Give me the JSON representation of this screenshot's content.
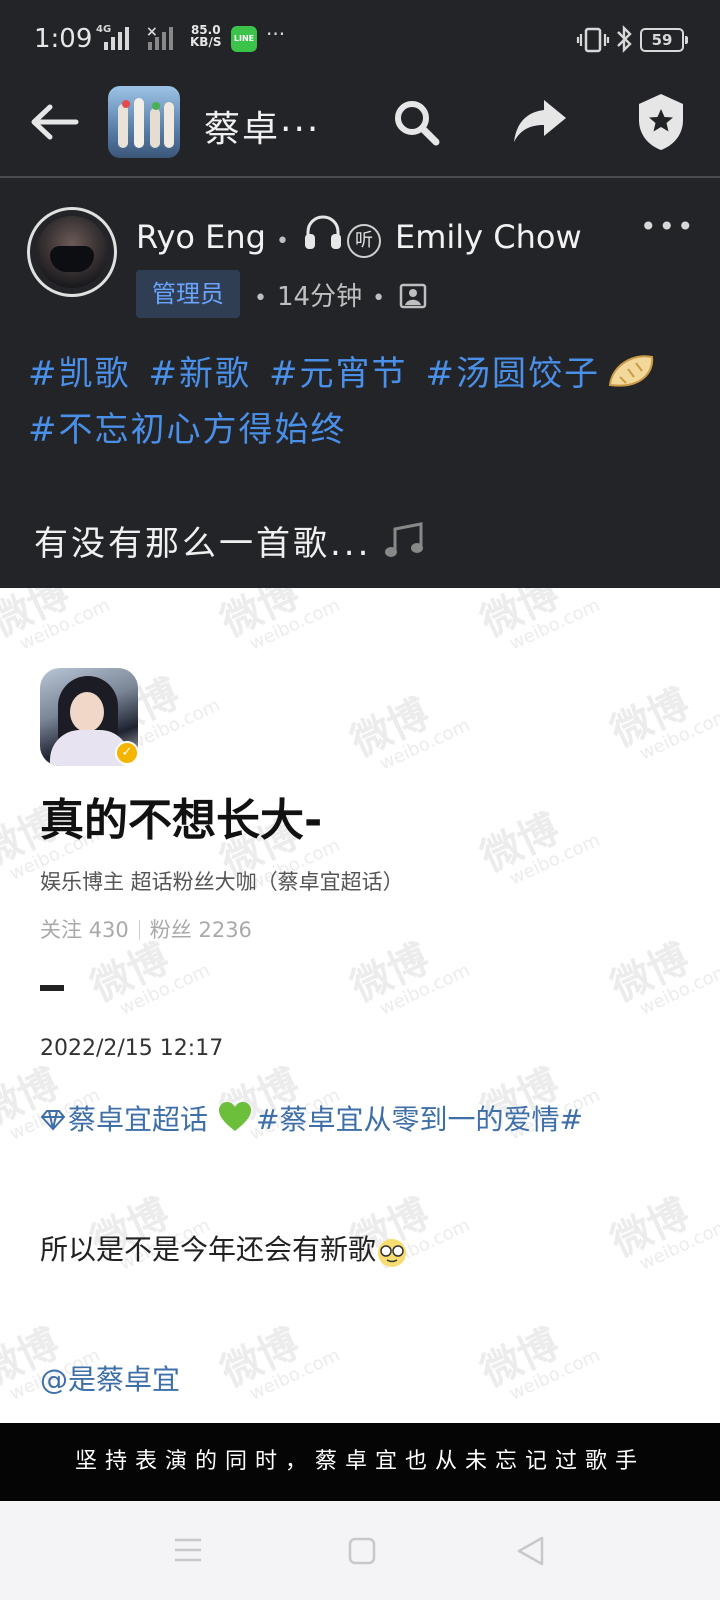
{
  "status_bar": {
    "time": "1:09",
    "net1": "4G",
    "speed_value": "85.0",
    "speed_unit": "KB/S",
    "line_app": "LINE",
    "more": "···",
    "battery": "59"
  },
  "app_bar": {
    "title": "蔡卓···"
  },
  "post": {
    "author": "Ryo Eng",
    "listen_badge": "听",
    "coauthor": "Emily Chow",
    "role_badge": "管理员",
    "time_ago": "14分钟",
    "hashtags": [
      "#凯歌",
      "#新歌",
      "#元宵节",
      "#汤圆饺子"
    ],
    "hashtag_line2": "#不忘初心方得始终",
    "text": "有没有那么一首歌..."
  },
  "weibo_card": {
    "name": "真的不想长大-",
    "description": "娱乐博主 超话粉丝大咖（蔡卓宜超话）",
    "following_label": "关注",
    "following": "430",
    "followers_label": "粉丝",
    "followers": "2236",
    "date": "2022/2/15 12:17",
    "topic": "蔡卓宜超话",
    "topic2": "#蔡卓宜从零到一的爱情#",
    "text": "所以是不是今年还会有新歌",
    "mention": "@是蔡卓宜",
    "watermark": "微博",
    "watermark_sub": "weibo.com"
  },
  "subtitle": "坚持表演的同时，蔡卓宜也从未忘记过歌手",
  "colors": {
    "dark_bg": "#232427",
    "link_blue": "#4a8fe8",
    "weibo_link": "#3f6fa8",
    "admin_badge_bg": "#2f3e53"
  }
}
